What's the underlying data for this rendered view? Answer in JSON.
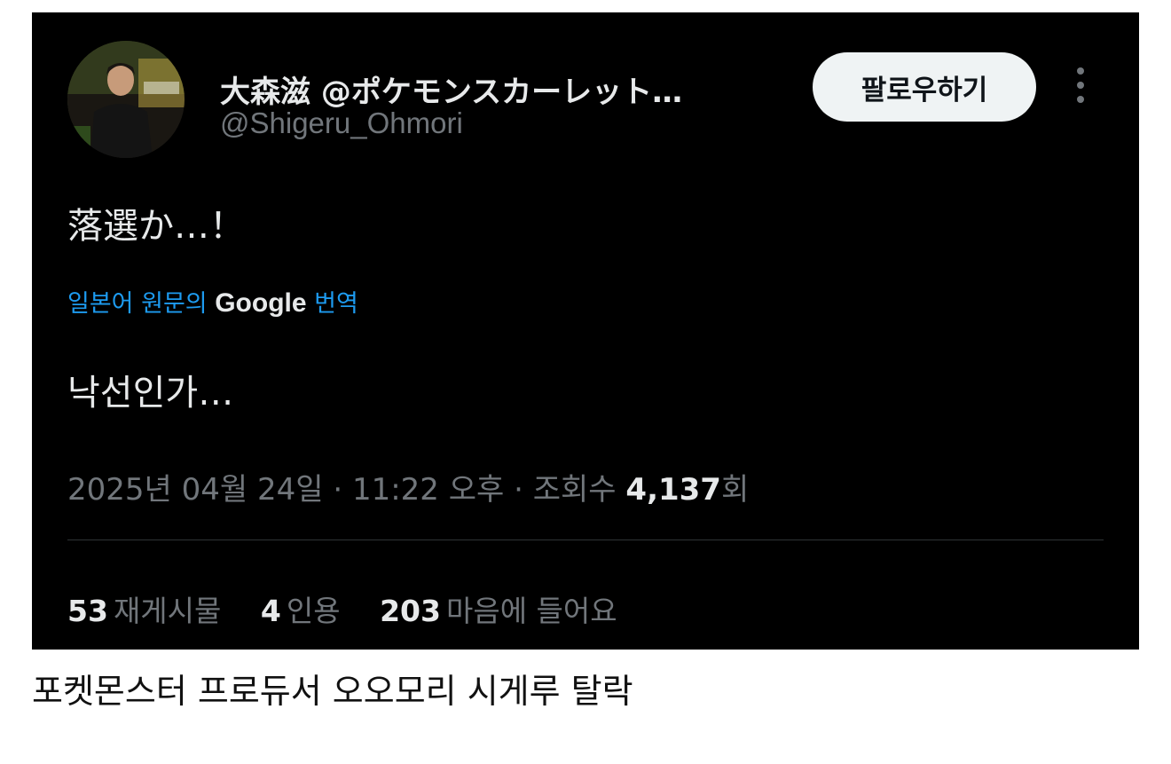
{
  "tweet": {
    "display_name": "大森滋 @ポケモンスカーレット…",
    "handle": "@Shigeru_Ohmori",
    "follow_label": "팔로우하기",
    "original_text": "落選か…！",
    "translation": {
      "prefix": "일본어 원문의 ",
      "provider": "Google",
      "suffix": " 번역"
    },
    "translated_text": "낙선인가…",
    "meta": {
      "date": "2025년 04월 24일",
      "sep1": " · ",
      "time": "11:22 오후",
      "sep2": " · ",
      "views_label": "조회수 ",
      "views_count": "4,137",
      "views_unit": "회"
    },
    "stats": {
      "reposts_count": "53",
      "reposts_label": "재게시물",
      "quotes_count": "4",
      "quotes_label": "인용",
      "likes_count": "203",
      "likes_label": "마음에 들어요"
    }
  },
  "caption": "포켓몬스터 프로듀서 오오모리 시게루 탈락",
  "colors": {
    "background": "#000000",
    "text": "#e7e9ea",
    "secondary": "#71767b",
    "link": "#1d9bf0"
  }
}
